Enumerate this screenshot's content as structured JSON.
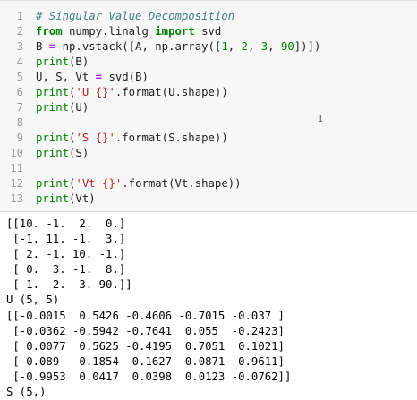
{
  "code_cell": {
    "lines": [
      {
        "num": "1",
        "parts": [
          {
            "cls": "cm",
            "text": "# Singular Value Decomposition"
          }
        ]
      },
      {
        "num": "2",
        "parts": [
          {
            "cls": "kw",
            "text": "from"
          },
          {
            "cls": "src",
            "text": " numpy.linalg "
          },
          {
            "cls": "kw",
            "text": "import"
          },
          {
            "cls": "src",
            "text": " svd"
          }
        ]
      },
      {
        "num": "3",
        "parts": [
          {
            "cls": "src",
            "text": "B "
          },
          {
            "cls": "op",
            "text": "="
          },
          {
            "cls": "src",
            "text": " np.vstack([A, np.array(["
          },
          {
            "cls": "nm",
            "text": "1"
          },
          {
            "cls": "src",
            "text": ", "
          },
          {
            "cls": "nm",
            "text": "2"
          },
          {
            "cls": "src",
            "text": ", "
          },
          {
            "cls": "nm",
            "text": "3"
          },
          {
            "cls": "src",
            "text": ", "
          },
          {
            "cls": "nm",
            "text": "90"
          },
          {
            "cls": "src",
            "text": "])])"
          }
        ]
      },
      {
        "num": "4",
        "parts": [
          {
            "cls": "nm",
            "text": "print"
          },
          {
            "cls": "src",
            "text": "(B)"
          }
        ]
      },
      {
        "num": "5",
        "parts": [
          {
            "cls": "src",
            "text": "U, S, Vt "
          },
          {
            "cls": "op",
            "text": "="
          },
          {
            "cls": "src",
            "text": " svd(B)"
          }
        ]
      },
      {
        "num": "6",
        "parts": [
          {
            "cls": "nm",
            "text": "print"
          },
          {
            "cls": "src",
            "text": "("
          },
          {
            "cls": "st",
            "text": "'U {}'"
          },
          {
            "cls": "src",
            "text": ".format(U.shape))"
          }
        ]
      },
      {
        "num": "7",
        "parts": [
          {
            "cls": "nm",
            "text": "print"
          },
          {
            "cls": "src",
            "text": "(U)"
          }
        ]
      },
      {
        "num": "8",
        "parts": []
      },
      {
        "num": "9",
        "parts": [
          {
            "cls": "nm",
            "text": "print"
          },
          {
            "cls": "src",
            "text": "("
          },
          {
            "cls": "st",
            "text": "'S {}'"
          },
          {
            "cls": "src",
            "text": ".format(S.shape))"
          }
        ]
      },
      {
        "num": "10",
        "parts": [
          {
            "cls": "nm",
            "text": "print"
          },
          {
            "cls": "src",
            "text": "(S)"
          }
        ]
      },
      {
        "num": "11",
        "parts": []
      },
      {
        "num": "12",
        "parts": [
          {
            "cls": "nm",
            "text": "print"
          },
          {
            "cls": "src",
            "text": "("
          },
          {
            "cls": "st",
            "text": "'Vt {}'"
          },
          {
            "cls": "src",
            "text": ".format(Vt.shape))"
          }
        ]
      },
      {
        "num": "13",
        "parts": [
          {
            "cls": "nm",
            "text": "print"
          },
          {
            "cls": "src",
            "text": "(Vt)"
          }
        ]
      }
    ]
  },
  "output": {
    "lines": [
      "[[10. -1.  2.  0.]",
      " [-1. 11. -1.  3.]",
      " [ 2. -1. 10. -1.]",
      " [ 0.  3. -1.  8.]",
      " [ 1.  2.  3. 90.]]",
      "U (5, 5)",
      "[[-0.0015  0.5426 -0.4606 -0.7015 -0.037 ]",
      " [-0.0362 -0.5942 -0.7641  0.055  -0.2423]",
      " [ 0.0077  0.5625 -0.4195  0.7051  0.1021]",
      " [-0.089  -0.1854 -0.1627 -0.0871  0.9611]",
      " [-0.9953  0.0417  0.0398  0.0123 -0.0762]]",
      "S (5,)"
    ]
  },
  "colors": {
    "cell_background": "#f7f7f7",
    "keyword": "#008000",
    "comment": "#408080",
    "string": "#ba2121",
    "operator": "#aa22ff",
    "line_number": "#999999"
  },
  "icons": {
    "text_cursor": "I-beam"
  }
}
